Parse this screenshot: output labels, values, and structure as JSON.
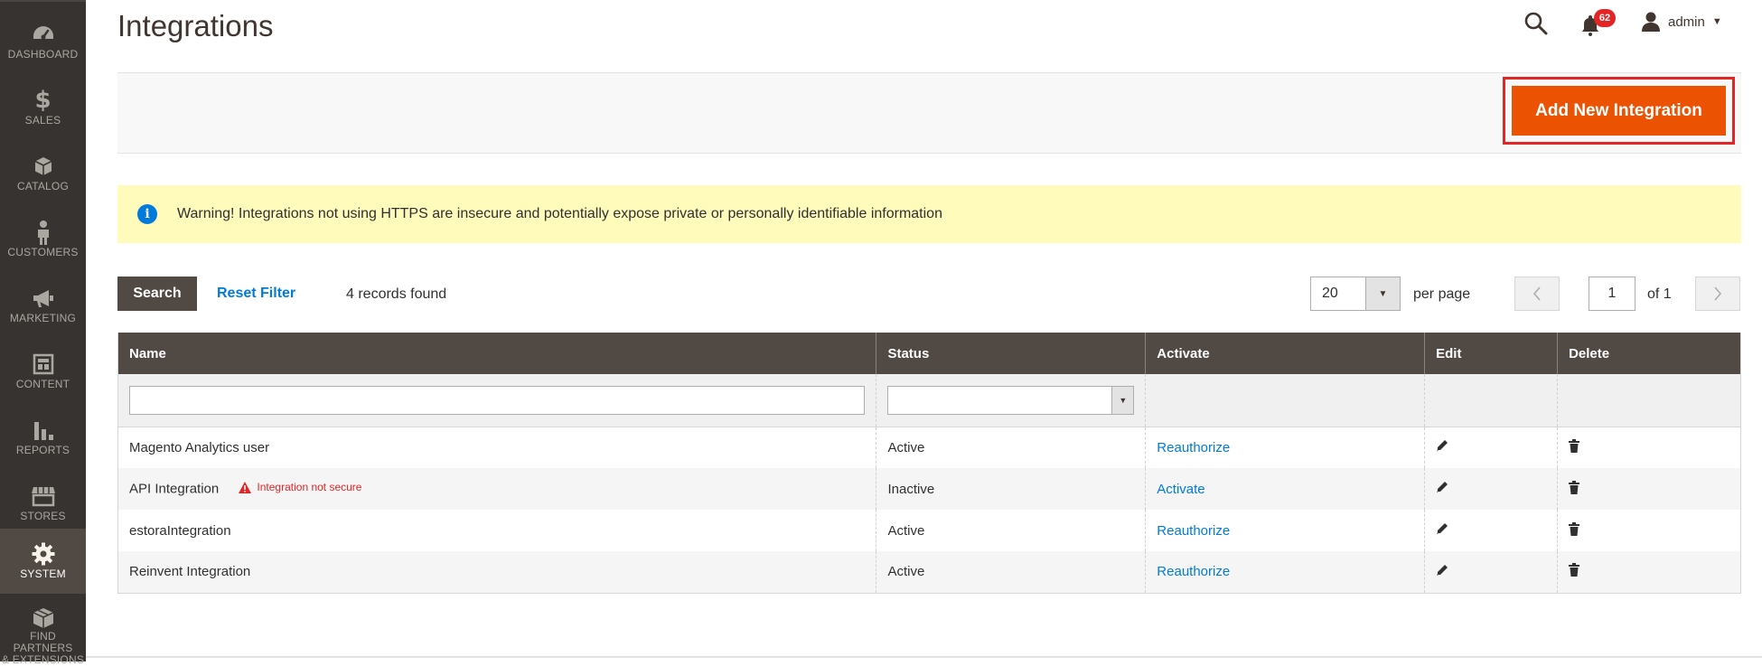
{
  "sidebar": {
    "items": [
      {
        "label": "DASHBOARD",
        "icon": "dashboard-icon"
      },
      {
        "label": "SALES",
        "icon": "dollar-icon"
      },
      {
        "label": "CATALOG",
        "icon": "box-icon"
      },
      {
        "label": "CUSTOMERS",
        "icon": "person-icon"
      },
      {
        "label": "MARKETING",
        "icon": "megaphone-icon"
      },
      {
        "label": "CONTENT",
        "icon": "layout-icon"
      },
      {
        "label": "REPORTS",
        "icon": "bar-chart-icon"
      },
      {
        "label": "STORES",
        "icon": "storefront-icon"
      },
      {
        "label": "SYSTEM",
        "icon": "gear-icon",
        "active": true
      },
      {
        "label1": "FIND PARTNERS",
        "label2": "& EXTENSIONS",
        "icon": "cube-icon"
      }
    ]
  },
  "header": {
    "title": "Integrations",
    "notifications_count": "62",
    "user": "admin"
  },
  "actions": {
    "add_label": "Add New Integration",
    "accent": "#eb5202"
  },
  "warning": {
    "text": "Warning! Integrations not using HTTPS are insecure and potentially expose private or personally identifiable information"
  },
  "toolbar": {
    "search_label": "Search",
    "reset_label": "Reset Filter",
    "records": "4 records found",
    "per_page_value": "20",
    "per_page_label": "per page",
    "page": "1",
    "of_label": "of 1"
  },
  "grid": {
    "columns": [
      "Name",
      "Status",
      "Activate",
      "Edit",
      "Delete"
    ],
    "rows": [
      {
        "name": "Magento Analytics user",
        "status": "Active",
        "activate": "Reauthorize",
        "insecure": ""
      },
      {
        "name": "API Integration",
        "status": "Inactive",
        "activate": "Activate",
        "insecure": "Integration not secure"
      },
      {
        "name": "estoraIntegration",
        "status": "Active",
        "activate": "Reauthorize",
        "insecure": ""
      },
      {
        "name": "Reinvent Integration",
        "status": "Active",
        "activate": "Reauthorize",
        "insecure": ""
      }
    ]
  }
}
